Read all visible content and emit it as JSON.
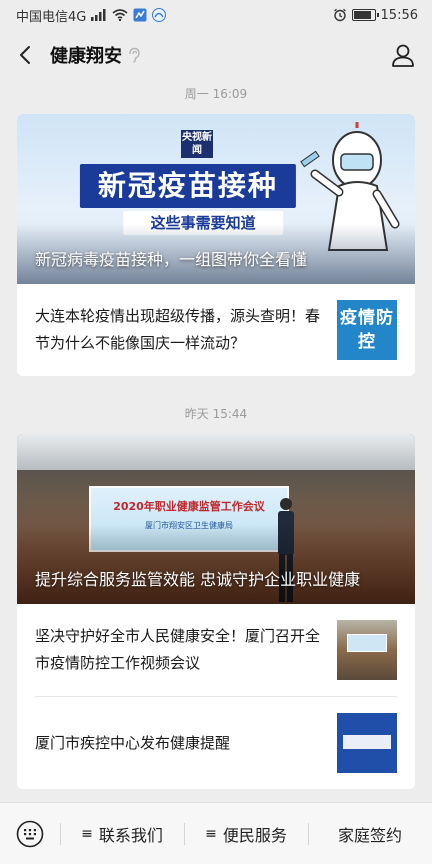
{
  "status": {
    "carrier": "中国电信4G",
    "time": "15:56"
  },
  "nav": {
    "title": "健康翔安"
  },
  "groups": [
    {
      "time": "周一 16:09",
      "cover": {
        "title": "新冠病毒疫苗接种，一组图带你全看懂",
        "image_text": {
          "badge": "央视新闻",
          "banner": "新冠疫苗接种",
          "sub": "这些事需要知道"
        }
      },
      "items": [
        {
          "text": "大连本轮疫情出现超级传播，源头查明！春节为什么不能像国庆一样流动？",
          "thumb_text": "疫情防控"
        }
      ]
    },
    {
      "time": "昨天 15:44",
      "cover": {
        "title": "提升综合服务监管效能 忠诚守护企业职业健康",
        "image_text": {
          "screen_title": "2020年职业健康监管工作会议",
          "screen_sub": "厦门市翔安区卫生健康局"
        }
      },
      "items": [
        {
          "text": "坚决守护好全市人民健康安全！厦门召开全市疫情防控工作视频会议"
        },
        {
          "text": "厦门市疾控中心发布健康提醒"
        }
      ]
    }
  ],
  "bottom_menu": [
    "联系我们",
    "便民服务",
    "家庭签约"
  ]
}
